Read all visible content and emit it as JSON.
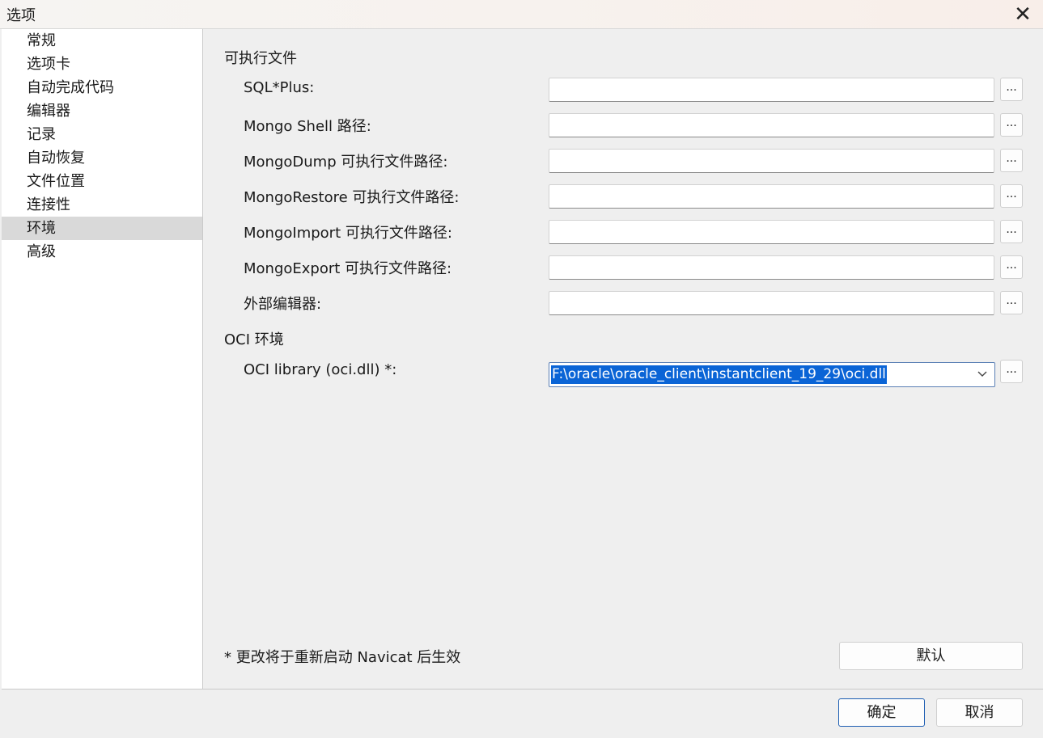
{
  "window": {
    "title": "选项",
    "close_glyph": "✕"
  },
  "sidebar": {
    "items": [
      {
        "label": "常规"
      },
      {
        "label": "选项卡"
      },
      {
        "label": "自动完成代码"
      },
      {
        "label": "编辑器"
      },
      {
        "label": "记录"
      },
      {
        "label": "自动恢复"
      },
      {
        "label": "文件位置"
      },
      {
        "label": "连接性"
      },
      {
        "label": "环境",
        "selected": true
      },
      {
        "label": "高级"
      }
    ]
  },
  "main": {
    "executables": {
      "section_title": "可执行文件",
      "rows": [
        {
          "label": "SQL*Plus:",
          "value": ""
        },
        {
          "label": "Mongo Shell 路径:",
          "value": ""
        },
        {
          "label": "MongoDump 可执行文件路径:",
          "value": ""
        },
        {
          "label": "MongoRestore 可执行文件路径:",
          "value": ""
        },
        {
          "label": "MongoImport 可执行文件路径:",
          "value": ""
        },
        {
          "label": "MongoExport 可执行文件路径:",
          "value": ""
        },
        {
          "label": "外部编辑器:",
          "value": ""
        }
      ]
    },
    "oci": {
      "section_title": "OCI 环境",
      "label": "OCI library (oci.dll) *:",
      "value": "F:\\oracle\\oracle_client\\instantclient_19_29\\oci.dll"
    },
    "browse_label": "...",
    "note": "* 更改将于重新启动 Navicat 后生效",
    "default_button": "默认"
  },
  "footer": {
    "ok": "确定",
    "cancel": "取消"
  },
  "colors": {
    "selection": "#0a64d6",
    "primary_border": "#1f5fb3"
  }
}
